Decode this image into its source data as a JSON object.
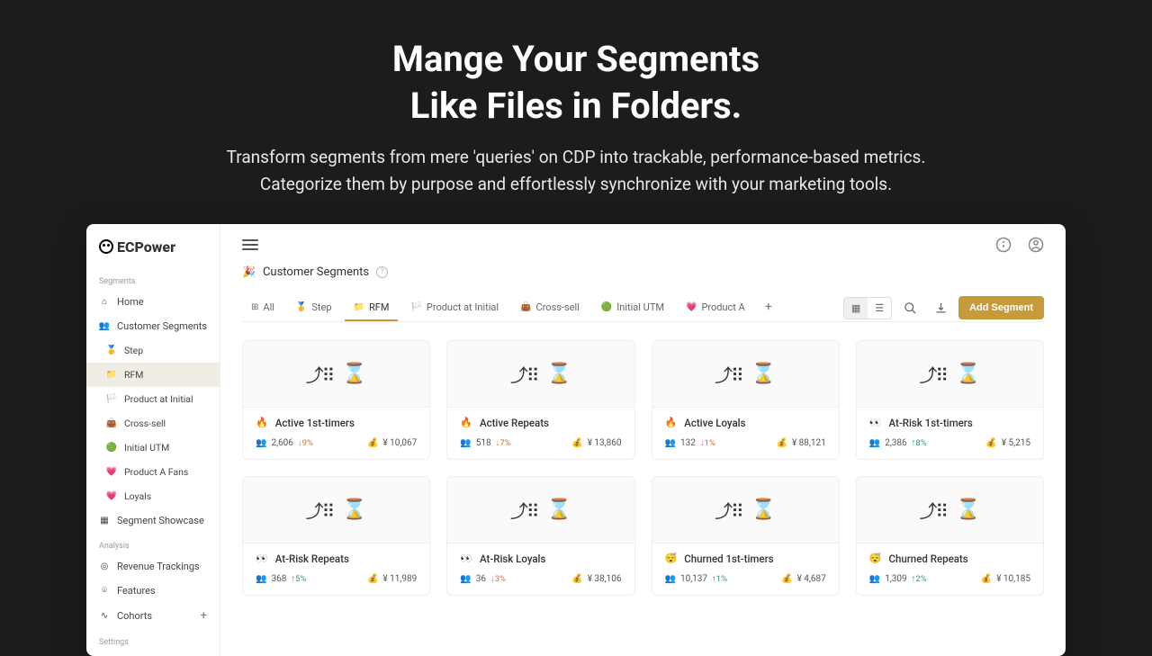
{
  "hero": {
    "title_l1": "Mange Your Segments",
    "title_l2": "Like Files in Folders.",
    "sub_l1": "Transform segments from mere 'queries' on CDP into trackable, performance-based metrics.",
    "sub_l2": "Categorize them by purpose and effortlessly synchronize with your marketing tools."
  },
  "brand": "ECPower",
  "sidebar": {
    "sections": {
      "segments": "Segments",
      "analysis": "Analysis",
      "settings": "Settings"
    },
    "items": {
      "home": "Home",
      "customer_segments": "Customer Segments",
      "step": "Step",
      "rfm": "RFM",
      "product_initial": "Product at Initial",
      "cross_sell": "Cross-sell",
      "initial_utm": "Initial UTM",
      "product_a_fans": "Product A Fans",
      "loyals": "Loyals",
      "segment_showcase": "Segment Showcase",
      "revenue_trackings": "Revenue Trackings",
      "features": "Features",
      "cohorts": "Cohorts"
    }
  },
  "crumb": {
    "label": "Customer Segments"
  },
  "tabs": {
    "all": "All",
    "step": "Step",
    "rfm": "RFM",
    "product_initial": "Product at Initial",
    "cross_sell": "Cross-sell",
    "initial_utm": "Initial UTM",
    "product_a": "Product A"
  },
  "buttons": {
    "add_segment": "Add Segment"
  },
  "cards": [
    {
      "icon": "🔥",
      "title": "Active 1st-timers",
      "count": "2,606",
      "delta": "9%",
      "dir": "down",
      "rev": "¥ 10,067"
    },
    {
      "icon": "🔥",
      "title": "Active Repeats",
      "count": "518",
      "delta": "7%",
      "dir": "down",
      "rev": "¥ 13,860"
    },
    {
      "icon": "🔥",
      "title": "Active Loyals",
      "count": "132",
      "delta": "1%",
      "dir": "down",
      "rev": "¥ 88,121"
    },
    {
      "icon": "👀",
      "title": "At-Risk 1st-timers",
      "count": "2,386",
      "delta": "8%",
      "dir": "up",
      "rev": "¥ 5,215"
    },
    {
      "icon": "👀",
      "title": "At-Risk Repeats",
      "count": "368",
      "delta": "5%",
      "dir": "up",
      "rev": "¥ 11,989"
    },
    {
      "icon": "👀",
      "title": "At-Risk Loyals",
      "count": "36",
      "delta": "3%",
      "dir": "down",
      "rev": "¥ 38,106"
    },
    {
      "icon": "😴",
      "title": "Churned 1st-timers",
      "count": "10,137",
      "delta": "1%",
      "dir": "up",
      "rev": "¥ 4,687"
    },
    {
      "icon": "😴",
      "title": "Churned Repeats",
      "count": "1,309",
      "delta": "2%",
      "dir": "up",
      "rev": "¥ 10,185"
    }
  ]
}
